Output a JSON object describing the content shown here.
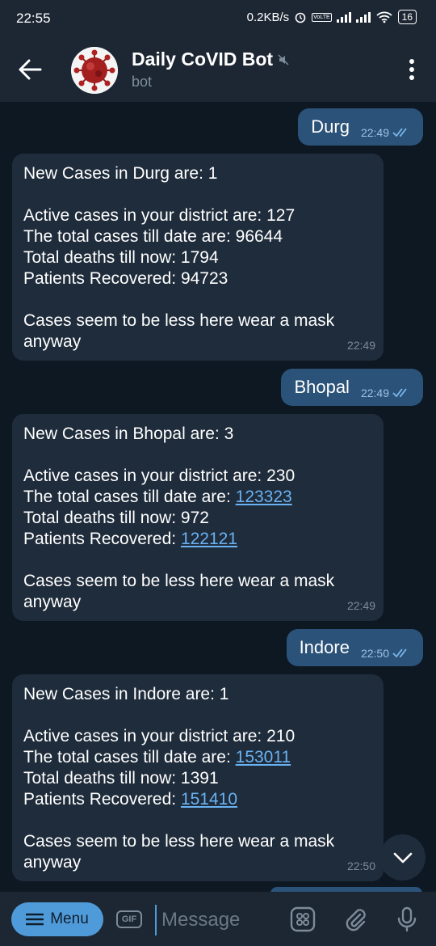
{
  "status_bar": {
    "time": "22:55",
    "net_speed": "0.2KB/s",
    "volte": "VoLTE",
    "battery": "16"
  },
  "header": {
    "title": "Daily CoVID Bot",
    "subtitle": "bot",
    "icons": [
      "back-arrow-icon",
      "mute-icon",
      "more-vert-icon"
    ]
  },
  "messages": [
    {
      "kind": "out",
      "text": "Durg",
      "time": "22:49"
    },
    {
      "kind": "in",
      "time": "22:49",
      "new_cases": "New Cases in Durg are: 1",
      "active": "Active cases in your district are: 127",
      "total_label": "The total cases till date are: ",
      "total_value": "96644",
      "deaths": "Total deaths till now: 1794",
      "recovered_label": "Patients Recovered: ",
      "recovered_value": "94723",
      "advice_1": "Cases seem to be less here wear a mask",
      "advice_2": "anyway"
    },
    {
      "kind": "out",
      "text": "Bhopal",
      "time": "22:49"
    },
    {
      "kind": "in",
      "time": "22:49",
      "new_cases": "New Cases in Bhopal are: 3",
      "active": "Active cases in your district are: 230",
      "total_label": "The total cases till date are: ",
      "total_value": "123323",
      "deaths": "Total deaths till now: 972",
      "recovered_label": "Patients Recovered: ",
      "recovered_value": "122121",
      "advice_1": "Cases seem to be less here wear a mask",
      "advice_2": "anyway"
    },
    {
      "kind": "out",
      "text": "Indore",
      "time": "22:50"
    },
    {
      "kind": "in",
      "time": "22:50",
      "new_cases": "New Cases in Indore are: 1",
      "active": "Active cases in your district are: 210",
      "total_label": "The total cases till date are: ",
      "total_value": "153011",
      "deaths": "Total deaths till now: 1391",
      "recovered_label": "Patients Recovered: ",
      "recovered_value": "151410",
      "advice_1": "Cases seem to be less here wear a mask",
      "advice_2": "anyway"
    }
  ],
  "input_bar": {
    "menu_label": "Menu",
    "gif_label": "GIF",
    "placeholder": "Message"
  },
  "colors": {
    "outgoing_bubble": "#2b5278",
    "incoming_bubble": "#1f2c3b",
    "link": "#6ab2f2",
    "accent": "#4f9bd9"
  }
}
